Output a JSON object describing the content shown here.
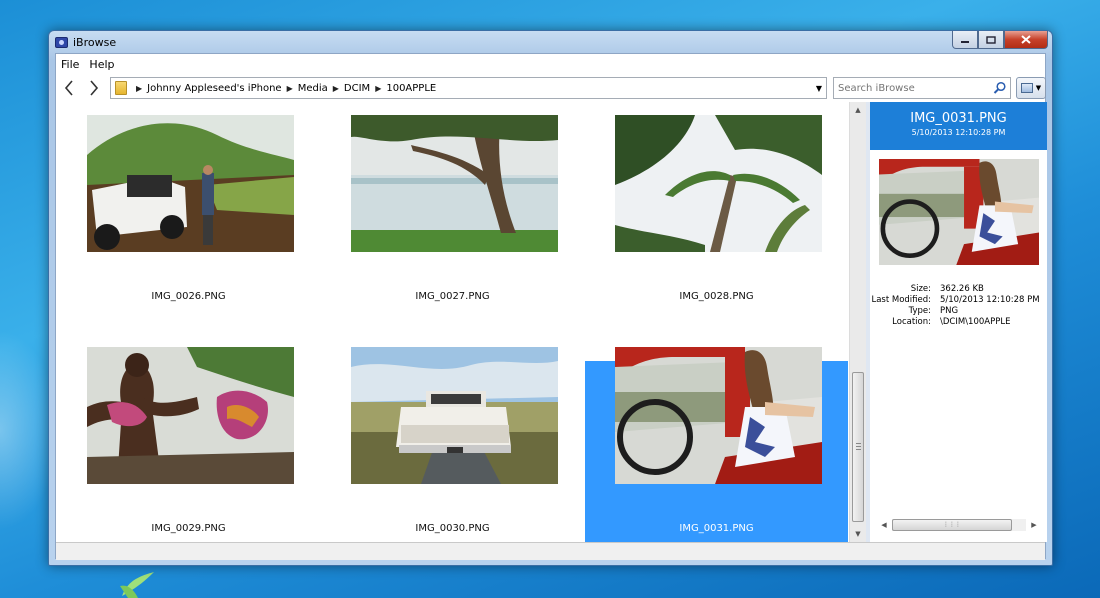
{
  "window": {
    "title": "iBrowse"
  },
  "menu": [
    "File",
    "Help"
  ],
  "nav": {
    "breadcrumb": [
      "Johnny Appleseed's iPhone",
      "Media",
      "DCIM",
      "100APPLE"
    ]
  },
  "search": {
    "placeholder": "Search iBrowse",
    "value": ""
  },
  "gallery": {
    "items": [
      {
        "name": "IMG_0026.PNG",
        "selected": false
      },
      {
        "name": "IMG_0027.PNG",
        "selected": false
      },
      {
        "name": "IMG_0028.PNG",
        "selected": false
      },
      {
        "name": "IMG_0029.PNG",
        "selected": false
      },
      {
        "name": "IMG_0030.PNG",
        "selected": false
      },
      {
        "name": "IMG_0031.PNG",
        "selected": true
      }
    ]
  },
  "details": {
    "title": "IMG_0031.PNG",
    "date": "5/10/2013 12:10:28 PM",
    "properties": [
      {
        "label": "Size:",
        "value": "362.26 KB"
      },
      {
        "label": "Last Modified:",
        "value": "5/10/2013 12:10:28 PM"
      },
      {
        "label": "Type:",
        "value": "PNG"
      },
      {
        "label": "Location:",
        "value": "\\DCIM\\100APPLE"
      }
    ]
  },
  "colors": {
    "selection": "#3399ff",
    "details_header": "#1d7fd8",
    "close_button": "#c7412a"
  },
  "icons": [
    "app-icon",
    "back-arrow-icon",
    "forward-arrow-icon",
    "folder-icon",
    "chevron-right-icon",
    "dropdown-arrow-icon",
    "search-icon",
    "view-options-icon",
    "minimize-icon",
    "maximize-icon",
    "close-icon"
  ]
}
